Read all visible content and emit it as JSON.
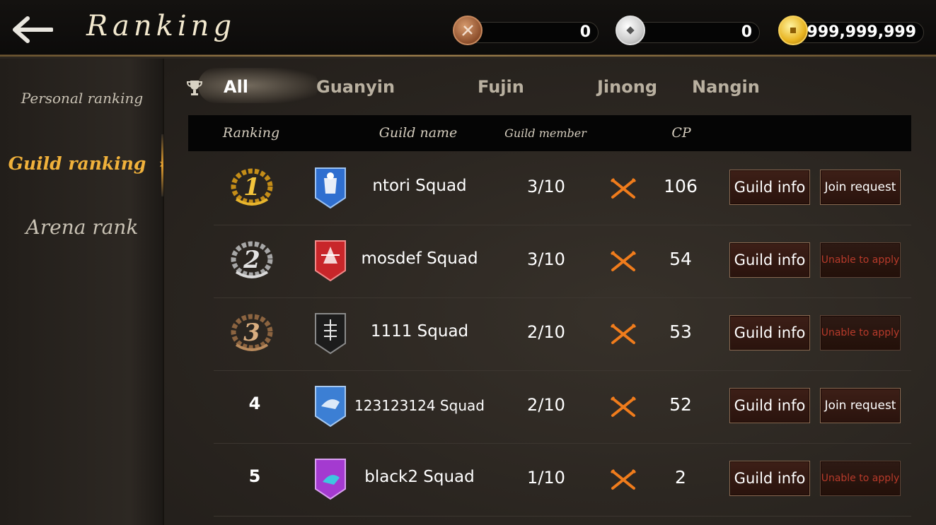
{
  "header": {
    "title": "Ranking",
    "back_icon": "back-arrow-icon",
    "currencies": [
      {
        "icon": "bronze-coin-icon",
        "amount": "0",
        "color": "#b86f45"
      },
      {
        "icon": "silver-coin-icon",
        "amount": "0",
        "color": "#d9d9d9"
      },
      {
        "icon": "gold-coin-icon",
        "amount": "999,999,999",
        "color": "#f2c230"
      }
    ]
  },
  "sidebar": {
    "items": [
      {
        "label": "Personal ranking",
        "active": false
      },
      {
        "label": "Guild ranking",
        "active": true
      },
      {
        "label": "Arena rank",
        "active": false
      }
    ]
  },
  "tabs": [
    {
      "label": "All",
      "active": true
    },
    {
      "label": "Guanyin",
      "active": false
    },
    {
      "label": "Fujin",
      "active": false
    },
    {
      "label": "Jinong",
      "active": false
    },
    {
      "label": "Nangin",
      "active": false
    }
  ],
  "table": {
    "columns": [
      "Ranking",
      "Guild name",
      "Guild member",
      "CP"
    ],
    "rows": [
      {
        "rank": "1",
        "name": "ntori Squad",
        "members": "3/10",
        "cp": "106",
        "info": "Guild info",
        "join": "Join request",
        "join_enabled": true,
        "emblem_color": "#2f6fd0"
      },
      {
        "rank": "2",
        "name": "mosdef Squad",
        "members": "3/10",
        "cp": "54",
        "info": "Guild info",
        "join": "Unable to apply",
        "join_enabled": false,
        "emblem_color": "#c8262a"
      },
      {
        "rank": "3",
        "name": "1111 Squad",
        "members": "2/10",
        "cp": "53",
        "info": "Guild info",
        "join": "Unable to apply",
        "join_enabled": false,
        "emblem_color": "#1c1c1c"
      },
      {
        "rank": "4",
        "name": "123123124 Squad",
        "members": "2/10",
        "cp": "52",
        "info": "Guild info",
        "join": "Join request",
        "join_enabled": true,
        "emblem_color": "#3c7fd4"
      },
      {
        "rank": "5",
        "name": "black2 Squad",
        "members": "1/10",
        "cp": "2",
        "info": "Guild info",
        "join": "Unable to apply",
        "join_enabled": false,
        "emblem_color": "#a43ad0"
      }
    ]
  },
  "colors": {
    "accent": "#f0b13b",
    "disabled_text": "#b73a2a",
    "swords": "#f07c1c",
    "medal_gold": "#e5ad2a",
    "medal_silver": "#cfcfcf",
    "medal_bronze": "#b88a5c"
  }
}
